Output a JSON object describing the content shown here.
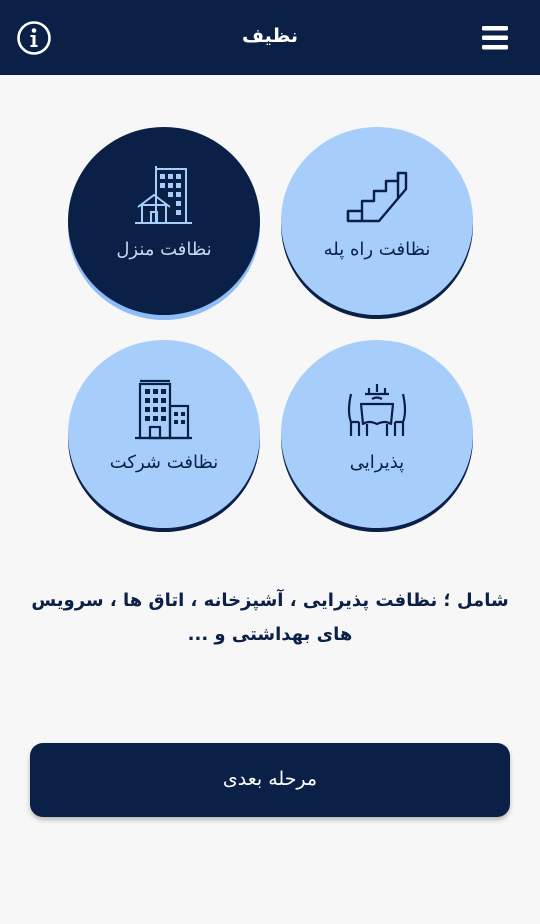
{
  "header": {
    "title": "نظیف",
    "info_icon": "info-circle-icon",
    "menu_icon": "hamburger-menu-icon"
  },
  "services": [
    {
      "label": "نظافت منزل",
      "icon": "home-building-icon",
      "selected": true
    },
    {
      "label": "نظافت راه پله",
      "icon": "stairs-icon",
      "selected": false
    },
    {
      "label": "نظافت شرکت",
      "icon": "office-building-icon",
      "selected": false
    },
    {
      "label": "پذیرایی",
      "icon": "dining-table-icon",
      "selected": false
    }
  ],
  "description": "شامل ؛ نظافت پذیرایی ، آشپزخانه ، اتاق ها ، سرویس های بهداشتی و ...",
  "next_button": {
    "label": "مرحله بعدی"
  },
  "colors": {
    "primary": "#0b2047",
    "light_blue": "#a7cdfb",
    "background": "#f7f7f7"
  }
}
